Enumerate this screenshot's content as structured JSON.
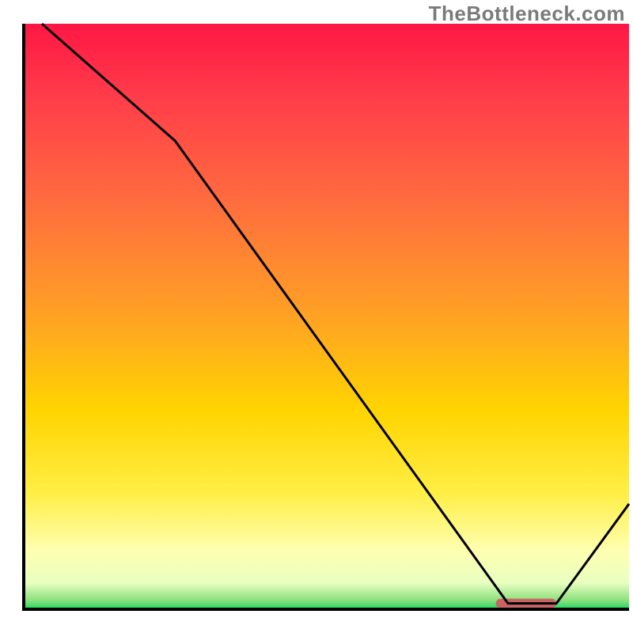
{
  "watermark": "TheBottleneck.com",
  "chart_data": {
    "type": "line",
    "title": "",
    "xlabel": "",
    "ylabel": "",
    "xlim": [
      0,
      100
    ],
    "ylim": [
      0,
      100
    ],
    "grid": false,
    "legend": false,
    "axes_visible": false,
    "series": [
      {
        "name": "bottleneck-curve",
        "x": [
          3,
          25,
          80,
          88,
          100
        ],
        "values": [
          100,
          80,
          1,
          1,
          18
        ],
        "color": "#000000",
        "width": 3
      }
    ],
    "optimal_marker": {
      "x_start": 78,
      "x_end": 88,
      "y": 1,
      "color": "#c86464",
      "thickness": 12
    },
    "background_gradient": {
      "type": "vertical",
      "stops": [
        {
          "pos": 0.0,
          "color": "#ff1744"
        },
        {
          "pos": 0.12,
          "color": "#ff3b4a"
        },
        {
          "pos": 0.3,
          "color": "#ff6b3f"
        },
        {
          "pos": 0.5,
          "color": "#ffa224"
        },
        {
          "pos": 0.66,
          "color": "#ffd400"
        },
        {
          "pos": 0.8,
          "color": "#ffee44"
        },
        {
          "pos": 0.9,
          "color": "#feffb0"
        },
        {
          "pos": 0.955,
          "color": "#e8ffc0"
        },
        {
          "pos": 0.985,
          "color": "#8be07c"
        },
        {
          "pos": 1.0,
          "color": "#17d860"
        }
      ]
    },
    "border": {
      "color": "#000000",
      "width": 4
    }
  }
}
